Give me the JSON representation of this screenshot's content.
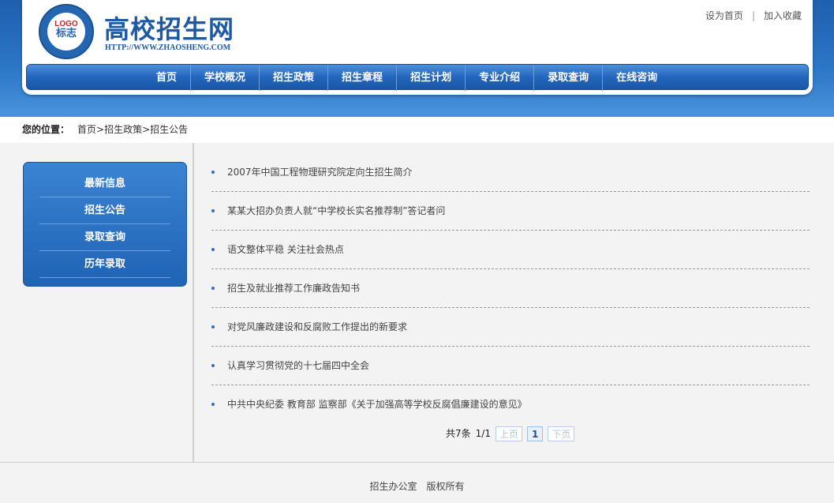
{
  "header": {
    "site_title": "高校招生网",
    "site_url": "HTTP://WWW.ZHAOSHENG.COM",
    "logo_text_top": "LOGO",
    "logo_text_main": "标志",
    "top_links": [
      "设为首页",
      "加入收藏"
    ]
  },
  "nav": {
    "items": [
      "首页",
      "学校概况",
      "招生政策",
      "招生章程",
      "招生计划",
      "专业介绍",
      "录取查询",
      "在线咨询"
    ]
  },
  "breadcrumb": {
    "label": "您的位置：",
    "path": "首页>招生政策>招生公告"
  },
  "sidebar": {
    "items": [
      "最新信息",
      "招生公告",
      "录取查询",
      "历年录取"
    ]
  },
  "news": {
    "items": [
      "2007年中国工程物理研究院定向生招生简介",
      "某某大招办负责人就“中学校长实名推荐制”答记者问",
      "语文整体平稳 关注社会热点",
      "招生及就业推荐工作廉政告知书",
      "对党风廉政建设和反腐败工作提出的新要求",
      "认真学习贯彻党的十七届四中全会",
      "中共中央纪委 教育部 监察部《关于加强高等学校反腐倡廉建设的意见》"
    ]
  },
  "pager": {
    "total": "共7条",
    "page_info": "1/1",
    "prev": "上页",
    "current": "1",
    "next": "下页"
  },
  "footer": {
    "text": "招生办公室　版权所有"
  },
  "colors": {
    "brand_blue": "#1d5aa6",
    "nav_blue": "#2366bd"
  }
}
